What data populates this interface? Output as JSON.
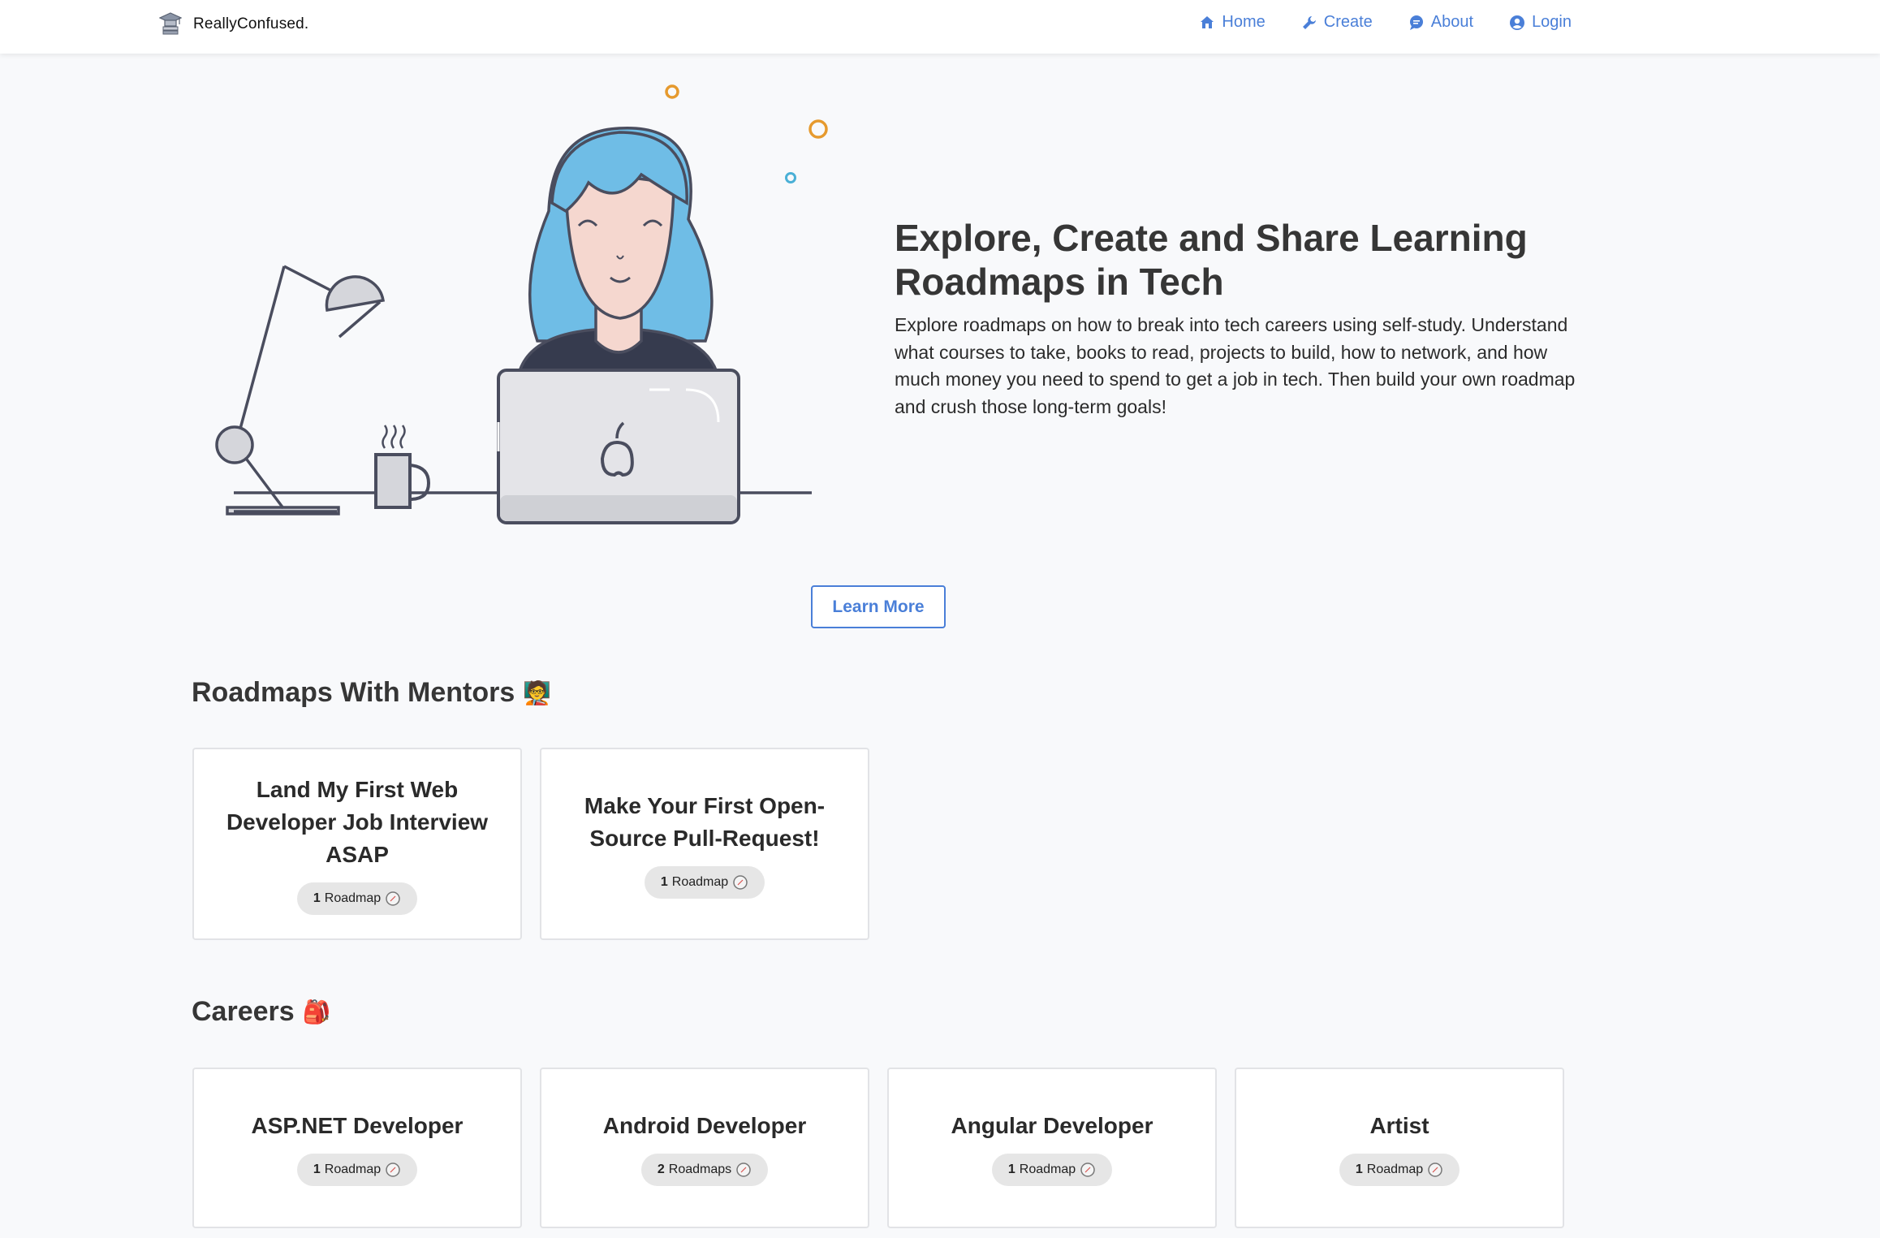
{
  "nav": {
    "brand": "ReallyConfused.",
    "links": [
      {
        "label": "Home",
        "icon": "home-icon"
      },
      {
        "label": "Create",
        "icon": "wrench-icon"
      },
      {
        "label": "About",
        "icon": "chat-bubble-icon"
      },
      {
        "label": "Login",
        "icon": "user-circle-icon"
      }
    ]
  },
  "hero": {
    "title": "Explore, Create and Share Learning Roadmaps in Tech",
    "description": "Explore roadmaps on how to break into tech careers using self-study. Understand what courses to take, books to read, projects to build, how to network, and how much money you need to spend to get a job in tech. Then build your own roadmap and crush those long-term goals!",
    "button": "Learn More"
  },
  "mentors": {
    "title": "Roadmaps With Mentors",
    "emoji": "🧑‍🏫",
    "cards": [
      {
        "title": "Land My First Web Developer Job Interview ASAP",
        "count": "1",
        "unit": "Roadmap"
      },
      {
        "title": "Make Your First Open-Source Pull-Request!",
        "count": "1",
        "unit": "Roadmap"
      }
    ]
  },
  "careers": {
    "title": "Careers",
    "emoji": "🎒",
    "cards": [
      {
        "title": "ASP.NET Developer",
        "count": "1",
        "unit": "Roadmap"
      },
      {
        "title": "Android Developer",
        "count": "2",
        "unit": "Roadmaps"
      },
      {
        "title": "Angular Developer",
        "count": "1",
        "unit": "Roadmap"
      },
      {
        "title": "Artist",
        "count": "1",
        "unit": "Roadmap"
      }
    ]
  },
  "colors": {
    "accent": "#4a7fd8",
    "hair": "#6fbde6",
    "skin": "#f5d7cf",
    "laptop": "#e4e4e8",
    "outline": "#4a4d5e"
  }
}
